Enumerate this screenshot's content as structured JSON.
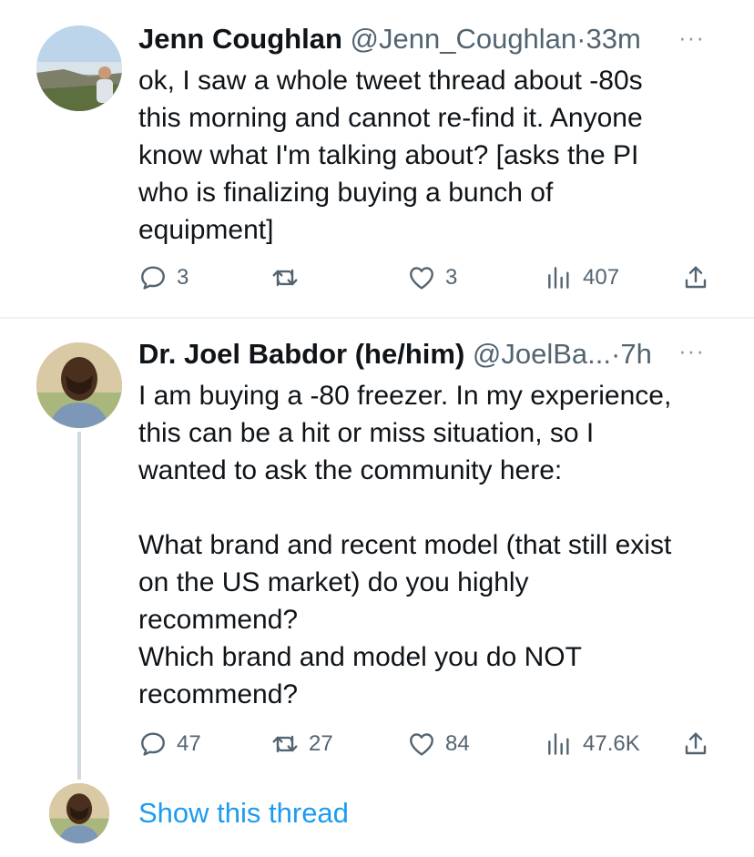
{
  "colors": {
    "text": "#0f1419",
    "secondary": "#536471",
    "link": "#1d9bf0",
    "divider": "#eff3f4",
    "thread_line": "#cfd9de"
  },
  "tweets": [
    {
      "name": "Jenn Coughlan",
      "handle": "@Jenn_Coughlan",
      "separator": "·",
      "time": "33m",
      "more": "···",
      "text_lines": [
        "ok, I saw a whole tweet thread about -80s",
        "this morning and cannot re-find it. Anyone",
        "know what I'm talking about? [asks the PI",
        "who is finalizing buying a bunch of",
        "equipment]"
      ],
      "replies": "3",
      "retweets": "",
      "likes": "3",
      "views": "407"
    },
    {
      "name": "Dr. Joel Babdor (he/him)",
      "handle": "@JoelBa...",
      "separator": "·",
      "time": "7h",
      "more": "···",
      "paragraph1": [
        "I am buying a -80 freezer. In my experience,",
        "this can be a hit or miss situation, so I",
        "wanted to ask the community here:"
      ],
      "paragraph2": [
        "What brand and recent model (that still exist",
        "on the US market) do you highly",
        "recommend?",
        "Which brand and model you do NOT",
        "recommend?"
      ],
      "replies": "47",
      "retweets": "27",
      "likes": "84",
      "views": "47.6K"
    }
  ],
  "show_thread": "Show this thread"
}
